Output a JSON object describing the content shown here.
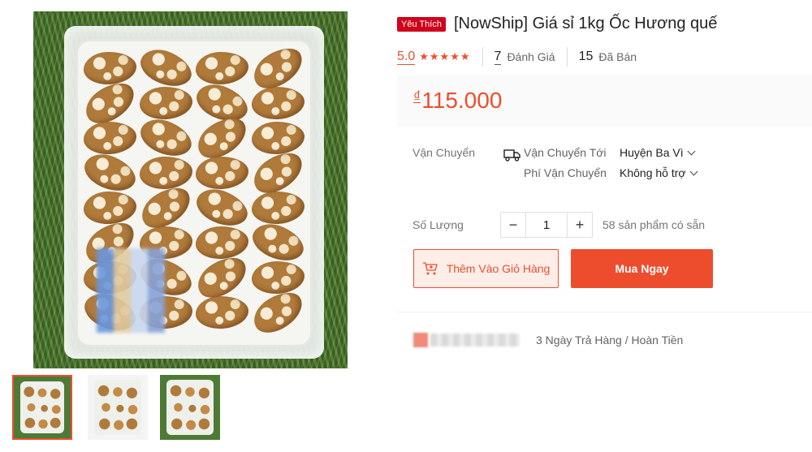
{
  "product": {
    "badge": "Yêu Thích",
    "title": "[NowShip] Giá sỉ 1kg Ốc Hương quế"
  },
  "stats": {
    "rating": "5.0",
    "stars": 5,
    "reviews_count": "7",
    "reviews_label": "Đánh Giá",
    "sold_count": "15",
    "sold_label": "Đã Bán"
  },
  "price": {
    "currency": "₫",
    "amount": "115.000"
  },
  "shipping": {
    "label": "Vận Chuyển",
    "to_label": "Vận Chuyển Tới",
    "to_value": "Huyện Ba Vì",
    "fee_label": "Phí Vận Chuyển",
    "fee_value": "Không hỗ trợ"
  },
  "quantity": {
    "label": "Số Lượng",
    "minus": "−",
    "value": "1",
    "plus": "+",
    "stock": "58 sản phẩm có sẵn"
  },
  "actions": {
    "add_to_cart": "Thêm Vào Giỏ Hàng",
    "buy_now": "Mua Ngay"
  },
  "guarantee": {
    "text": "3 Ngày Trả Hàng / Hoàn Tiền"
  },
  "colors": {
    "accent": "#ee4d2d",
    "badge": "#d0011b"
  },
  "icons": {
    "star": "star-icon",
    "shipping": "truck-icon",
    "cart": "cart-plus-icon",
    "dropdown": "chevron-down-icon"
  }
}
